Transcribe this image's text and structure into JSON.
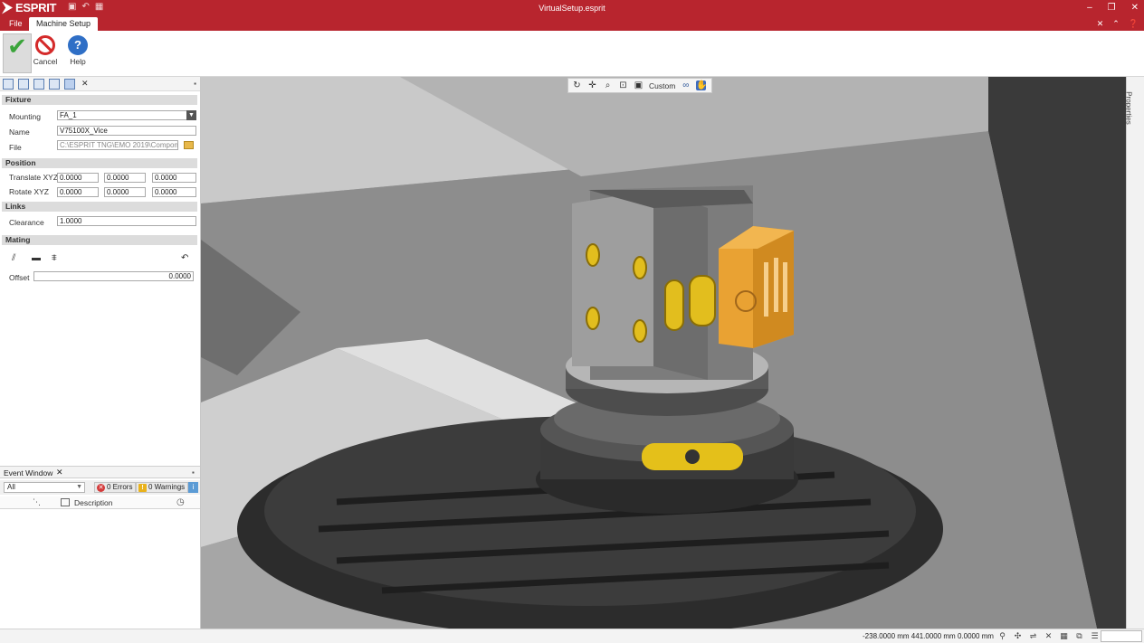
{
  "titlebar": {
    "app_name": "ESPRIT",
    "document_title": "VirtualSetup.esprit",
    "qat": [
      "save-icon",
      "undo-icon",
      "grid-icon"
    ],
    "window_controls": [
      "minimize-icon",
      "restore-icon",
      "close-icon"
    ]
  },
  "ribbon": {
    "tabs": [
      {
        "label": "File"
      },
      {
        "label": "Machine Setup"
      }
    ],
    "active_tab": "Machine Setup",
    "buttons": {
      "ok": {
        "label": "",
        "icon": "checkmark-icon"
      },
      "cancel": {
        "label": "Cancel",
        "icon": "cancel-icon"
      },
      "help": {
        "label": "Help",
        "icon": "help-icon",
        "glyph": "?"
      }
    },
    "right_controls": [
      "close-icon",
      "collapse-icon",
      "help-icon"
    ]
  },
  "panel": {
    "sections": {
      "fixture": "Fixture",
      "position": "Position",
      "links": "Links",
      "mating": "Mating"
    },
    "fixture": {
      "mounting_label": "Mounting",
      "mounting_value": "FA_1",
      "name_label": "Name",
      "name_value": "V75100X_Vice",
      "file_label": "File",
      "file_value": "C:\\ESPRIT TNG\\EMO 2019\\Componen"
    },
    "position": {
      "translate_label": "Translate XYZ",
      "translate": [
        "0.0000",
        "0.0000",
        "0.0000"
      ],
      "rotate_label": "Rotate XYZ",
      "rotate": [
        "0.0000",
        "0.0000",
        "0.0000"
      ]
    },
    "links": {
      "clearance_label": "Clearance",
      "clearance_value": "1.0000"
    },
    "mating": {
      "offset_label": "Offset",
      "offset_value": "0.0000"
    }
  },
  "event_window": {
    "title": "Event Window",
    "filter": "All",
    "errors": "0 Errors",
    "warnings": "0 Warnings",
    "column_description": "Description"
  },
  "view_toolbar": {
    "view_label": "Custom"
  },
  "properties_label": "Properties",
  "status": {
    "coords": "-238.0000 mm  441.0000 mm  0.0000 mm"
  },
  "colors": {
    "title_bar": "#b8252e",
    "fixture_highlight": "#e8a030",
    "part_yellow": "#e7c21a"
  }
}
